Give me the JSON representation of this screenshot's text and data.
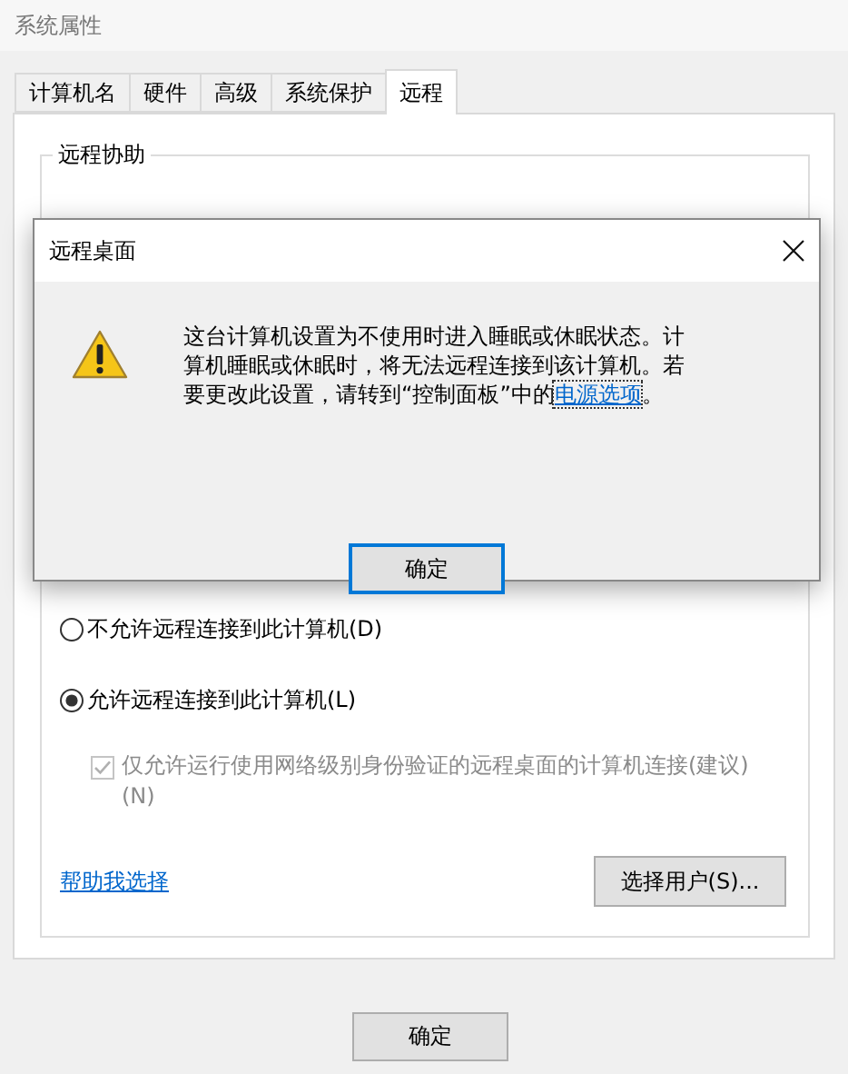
{
  "window": {
    "title": "系统属性"
  },
  "tabs": [
    {
      "label": "计算机名",
      "selected": false
    },
    {
      "label": "硬件",
      "selected": false
    },
    {
      "label": "高级",
      "selected": false
    },
    {
      "label": "系统保护",
      "selected": false
    },
    {
      "label": "远程",
      "selected": true
    }
  ],
  "remote_assistance": {
    "title": "远程协助"
  },
  "remote_desktop": {
    "options": [
      {
        "label": "不允许远程连接到此计算机(D)",
        "selected": false
      },
      {
        "label": "允许远程连接到此计算机(L)",
        "selected": true
      }
    ],
    "nla": {
      "label": "仅允许运行使用网络级别身份验证的远程桌面的计算机连接(建议)(N)",
      "checked": true,
      "disabled": true
    },
    "help_link": "帮助我选择",
    "select_users_button": "选择用户(S)..."
  },
  "buttons": [
    {
      "label": "确定"
    }
  ],
  "dialog": {
    "title": "远程桌面",
    "message": "这台计算机设置为不使用时进入睡眠或休眠状态。计算机睡眠或休眠时，将无法远程连接到该计算机。若要更改此设置，请转到“控制面板”中的",
    "link": "电源选项",
    "message_end": "。",
    "button": "确定"
  }
}
